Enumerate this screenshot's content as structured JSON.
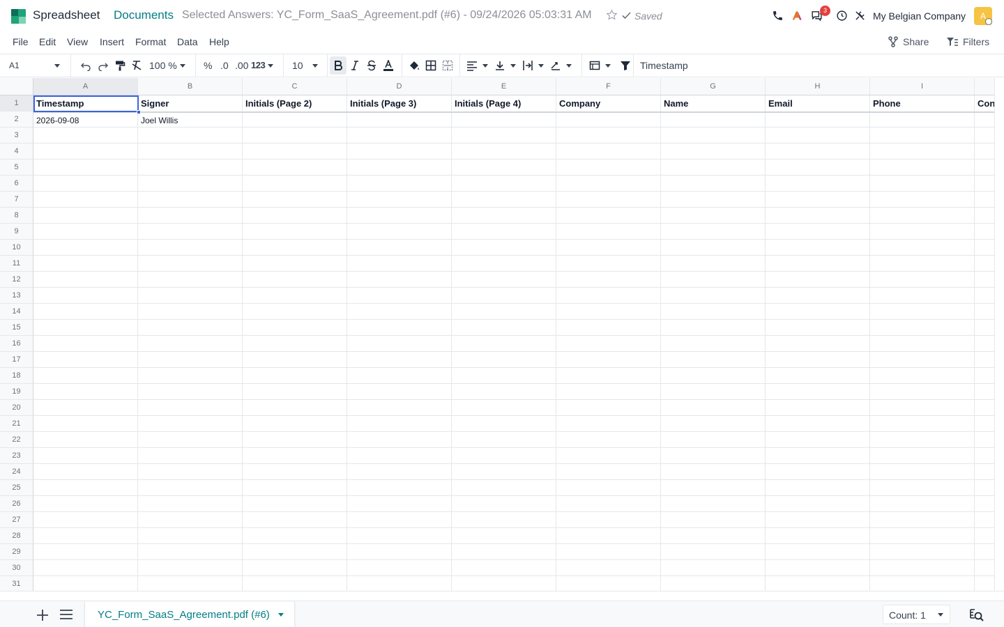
{
  "app": {
    "name": "Spreadsheet",
    "breadcrumb_root": "Documents",
    "file_title": "Selected Answers: YC_Form_SaaS_Agreement.pdf (#6) - 09/24/2026 05:03:31 AM",
    "saved_label": "Saved",
    "notification_count": "3",
    "company": "My Belgian Company",
    "avatar_letter": "A",
    "accent_color": "#017e84"
  },
  "menu": {
    "items": [
      "File",
      "Edit",
      "View",
      "Insert",
      "Format",
      "Data",
      "Help"
    ],
    "share_label": "Share",
    "filters_label": "Filters"
  },
  "toolbar": {
    "cell_reference": "A1",
    "zoom": "100 %",
    "percent_label": "%",
    "decrease_decimal_label": ".0",
    "increase_decimal_label": ".00",
    "number_format_label": "123",
    "font_size": "10",
    "formula_value": "Timestamp"
  },
  "sheet": {
    "columns": [
      "A",
      "B",
      "C",
      "D",
      "E",
      "F",
      "G",
      "H",
      "I",
      ""
    ],
    "header_row": [
      "Timestamp",
      "Signer",
      "Initials (Page 2)",
      "Initials (Page 3)",
      "Initials (Page 4)",
      "Company",
      "Name",
      "Email",
      "Phone",
      "Con"
    ],
    "rows": [
      [
        "2026-09-08",
        "Joel Willis",
        "",
        "",
        "",
        "",
        "",
        "",
        "",
        ""
      ]
    ],
    "row_numbers": [
      "1",
      "2",
      "3",
      "4",
      "5",
      "6",
      "7",
      "8",
      "9",
      "10",
      "11",
      "12",
      "13",
      "14",
      "15",
      "16",
      "17",
      "18",
      "19",
      "20",
      "21",
      "22",
      "23",
      "24",
      "25",
      "26",
      "27",
      "28",
      "29",
      "30",
      "31"
    ]
  },
  "footer": {
    "sheet_tab": "YC_Form_SaaS_Agreement.pdf (#6)",
    "count_label": "Count: 1"
  }
}
